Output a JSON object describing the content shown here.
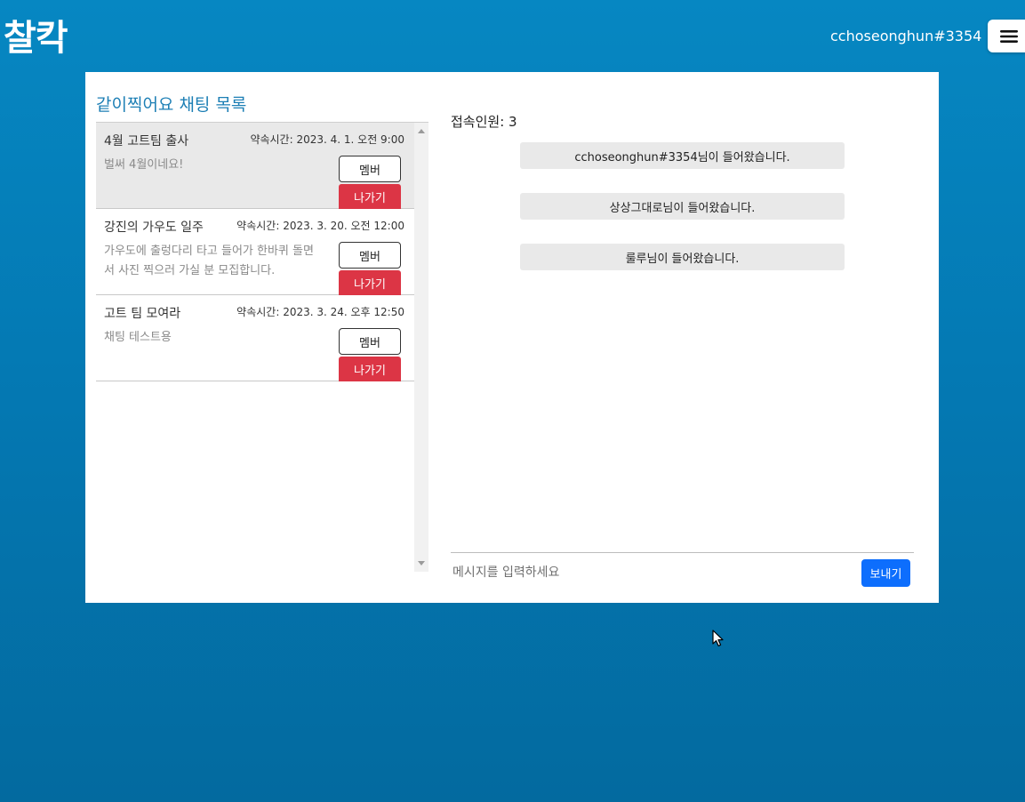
{
  "header": {
    "logo": "찰칵",
    "username": "cchoseonghun#3354",
    "menu_icon": "hamburger-menu-icon"
  },
  "chat_list": {
    "title": "같이찍어요 채팅 목록",
    "rooms": [
      {
        "name": "4월 고트팀 출사",
        "time": "약속시간: 2023. 4. 1. 오전 9:00",
        "desc": "벌써 4월이네요!",
        "member_label": "멤버",
        "leave_label": "나가기"
      },
      {
        "name": "강진의 가우도 일주",
        "time": "약속시간: 2023. 3. 20. 오전 12:00",
        "desc": "가우도에 출렁다리 타고 들어가 한바퀴 돌면서 사진 찍으러 가실 분 모집합니다.",
        "member_label": "멤버",
        "leave_label": "나가기"
      },
      {
        "name": "고트 팀 모여라",
        "time": "약속시간: 2023. 3. 24. 오후 12:50",
        "desc": "채팅 테스트용",
        "member_label": "멤버",
        "leave_label": "나가기"
      }
    ]
  },
  "chat_room": {
    "participant_count": "접속인원: 3",
    "system_messages": [
      "cchoseonghun#3354님이 들어왔습니다.",
      "상상그대로님이 들어왔습니다.",
      "룰루님이 들어왔습니다."
    ],
    "input_placeholder": "메시지를 입력하세요",
    "input_value": "",
    "send_label": "보내기"
  },
  "colors": {
    "background_top": "#0687c2",
    "background_bottom": "#036a9f",
    "title_blue": "#1d7fb5",
    "leave_red": "#dc3545",
    "send_blue": "#0d6efd",
    "active_row": "#e9e9e9"
  }
}
